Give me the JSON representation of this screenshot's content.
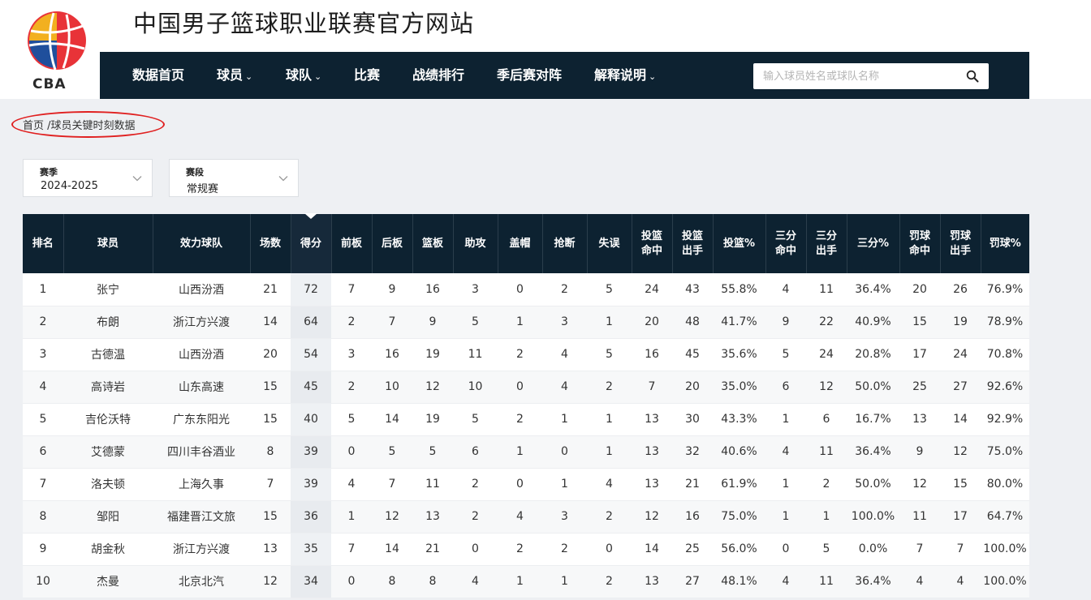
{
  "site": {
    "title": "中国男子篮球职业联赛官方网站",
    "logo_text": "CBA"
  },
  "nav": {
    "items": [
      {
        "label": "数据首页",
        "dropdown": false
      },
      {
        "label": "球员",
        "dropdown": true
      },
      {
        "label": "球队",
        "dropdown": true
      },
      {
        "label": "比赛",
        "dropdown": false
      },
      {
        "label": "战绩排行",
        "dropdown": false
      },
      {
        "label": "季后赛对阵",
        "dropdown": false
      },
      {
        "label": "解释说明",
        "dropdown": true
      }
    ],
    "search_placeholder": "输入球员姓名或球队名称"
  },
  "breadcrumb": {
    "home": "首页",
    "current": " /球员关键时刻数据"
  },
  "filters": {
    "season": {
      "label": "赛季",
      "value": "2024-2025"
    },
    "stage": {
      "label": "赛段",
      "value": "常规赛"
    }
  },
  "colors": {
    "nav_bg": "#0d2231",
    "highlight": "#e02020",
    "page_bg": "#eef0f3"
  },
  "table": {
    "sorted_column": "得分",
    "headers": [
      [
        "排名"
      ],
      [
        "球员"
      ],
      [
        "效力球队"
      ],
      [
        "场数"
      ],
      [
        "得分"
      ],
      [
        "前板"
      ],
      [
        "后板"
      ],
      [
        "篮板"
      ],
      [
        "助攻"
      ],
      [
        "盖帽"
      ],
      [
        "抢断"
      ],
      [
        "失误"
      ],
      [
        "投篮",
        "命中"
      ],
      [
        "投篮",
        "出手"
      ],
      [
        "投篮%"
      ],
      [
        "三分",
        "命中"
      ],
      [
        "三分",
        "出手"
      ],
      [
        "三分%"
      ],
      [
        "罚球",
        "命中"
      ],
      [
        "罚球",
        "出手"
      ],
      [
        "罚球%"
      ]
    ],
    "rows": [
      [
        "1",
        "张宁",
        "山西汾酒",
        "21",
        "72",
        "7",
        "9",
        "16",
        "3",
        "0",
        "2",
        "5",
        "24",
        "43",
        "55.8%",
        "4",
        "11",
        "36.4%",
        "20",
        "26",
        "76.9%"
      ],
      [
        "2",
        "布朗",
        "浙江方兴渡",
        "14",
        "64",
        "2",
        "7",
        "9",
        "5",
        "1",
        "3",
        "1",
        "20",
        "48",
        "41.7%",
        "9",
        "22",
        "40.9%",
        "15",
        "19",
        "78.9%"
      ],
      [
        "3",
        "古德温",
        "山西汾酒",
        "20",
        "54",
        "3",
        "16",
        "19",
        "11",
        "2",
        "4",
        "5",
        "16",
        "45",
        "35.6%",
        "5",
        "24",
        "20.8%",
        "17",
        "24",
        "70.8%"
      ],
      [
        "4",
        "高诗岩",
        "山东高速",
        "15",
        "45",
        "2",
        "10",
        "12",
        "10",
        "0",
        "4",
        "2",
        "7",
        "20",
        "35.0%",
        "6",
        "12",
        "50.0%",
        "25",
        "27",
        "92.6%"
      ],
      [
        "5",
        "吉伦沃特",
        "广东东阳光",
        "15",
        "40",
        "5",
        "14",
        "19",
        "5",
        "2",
        "1",
        "1",
        "13",
        "30",
        "43.3%",
        "1",
        "6",
        "16.7%",
        "13",
        "14",
        "92.9%"
      ],
      [
        "6",
        "艾德蒙",
        "四川丰谷酒业",
        "8",
        "39",
        "0",
        "5",
        "5",
        "6",
        "1",
        "0",
        "1",
        "13",
        "32",
        "40.6%",
        "4",
        "11",
        "36.4%",
        "9",
        "12",
        "75.0%"
      ],
      [
        "7",
        "洛夫顿",
        "上海久事",
        "7",
        "39",
        "4",
        "7",
        "11",
        "2",
        "0",
        "1",
        "4",
        "13",
        "21",
        "61.9%",
        "1",
        "2",
        "50.0%",
        "12",
        "15",
        "80.0%"
      ],
      [
        "8",
        "邹阳",
        "福建晋江文旅",
        "15",
        "36",
        "1",
        "12",
        "13",
        "2",
        "4",
        "3",
        "2",
        "12",
        "16",
        "75.0%",
        "1",
        "1",
        "100.0%",
        "11",
        "17",
        "64.7%"
      ],
      [
        "9",
        "胡金秋",
        "浙江方兴渡",
        "13",
        "35",
        "7",
        "14",
        "21",
        "0",
        "2",
        "2",
        "0",
        "14",
        "25",
        "56.0%",
        "0",
        "5",
        "0.0%",
        "7",
        "7",
        "100.0%"
      ],
      [
        "10",
        "杰曼",
        "北京北汽",
        "12",
        "34",
        "0",
        "8",
        "8",
        "4",
        "1",
        "1",
        "2",
        "13",
        "27",
        "48.1%",
        "4",
        "11",
        "36.4%",
        "4",
        "4",
        "100.0%"
      ]
    ]
  }
}
